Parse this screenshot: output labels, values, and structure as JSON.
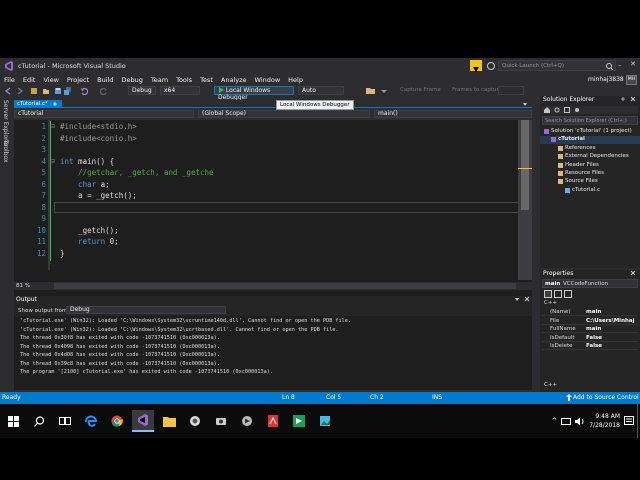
{
  "window": {
    "title": "cTutorial - Microsoft Visual Studio",
    "quick_launch": "Quick Launch (Ctrl+Q)",
    "user": "minhaj3838",
    "user_initials": "MH"
  },
  "menu": [
    "File",
    "Edit",
    "View",
    "Project",
    "Build",
    "Debug",
    "Team",
    "Tools",
    "Test",
    "Analyze",
    "Window",
    "Help"
  ],
  "toolbar": {
    "config": "Debug",
    "platform": "x64",
    "debugger_label": "Local Windows Debugger",
    "auto": "Auto",
    "capture_frame": "Capture Frame",
    "frames_to_capture": "Frames to capture:"
  },
  "tooltip": "Local Windows Debugger",
  "side_tabs": [
    "Server Explorer",
    "Toolbox"
  ],
  "editor": {
    "tab": "cTutorial.c*",
    "nav_project": "cTutorial",
    "nav_scope": "(Global Scope)",
    "nav_function": "main()",
    "zoom": "81 %",
    "lines": [
      {
        "n": "1",
        "segs": [
          {
            "t": "pp",
            "s": "#include<stdio.h>"
          }
        ]
      },
      {
        "n": "2",
        "segs": [
          {
            "t": "pp",
            "s": "#include<conio.h>"
          }
        ]
      },
      {
        "n": "3",
        "segs": []
      },
      {
        "n": "4",
        "segs": [
          {
            "t": "kw",
            "s": "int"
          },
          {
            "t": "tx",
            "s": " main() {"
          }
        ]
      },
      {
        "n": "5",
        "segs": [
          {
            "t": "cm",
            "s": "    //getchar, _getch, and _getche"
          }
        ]
      },
      {
        "n": "6",
        "segs": [
          {
            "t": "kw",
            "s": "    char"
          },
          {
            "t": "tx",
            "s": " a;"
          }
        ]
      },
      {
        "n": "7",
        "segs": [
          {
            "t": "tx",
            "s": "    a = _getch();"
          }
        ]
      },
      {
        "n": "8",
        "segs": []
      },
      {
        "n": "9",
        "segs": []
      },
      {
        "n": "10",
        "segs": [
          {
            "t": "tx",
            "s": "    _getch();"
          }
        ]
      },
      {
        "n": "11",
        "segs": [
          {
            "t": "kw",
            "s": "    return"
          },
          {
            "t": "tx",
            "s": " 0;"
          }
        ]
      },
      {
        "n": "12",
        "segs": [
          {
            "t": "tx",
            "s": "}"
          }
        ]
      }
    ]
  },
  "output": {
    "title": "Output",
    "show_from_label": "Show output from:",
    "show_from_value": "Debug",
    "lines": [
      "'cTutorial.exe' (Win32): Loaded 'C:\\Windows\\System32\\vcruntime140d.dll'. Cannot find or open the PDB file.",
      "'cTutorial.exe' (Win32): Loaded 'C:\\Windows\\System32\\ucrtbased.dll'. Cannot find or open the PDB file.",
      "The thread 0x30f8 has exited with code -1073741510 (0xc000013a).",
      "The thread 0x4098 has exited with code -1073741510 (0xc000013a).",
      "The thread 0x4d08 has exited with code -1073741510 (0xc000013a).",
      "The thread 0x39c8 has exited with code -1073741510 (0xc000013a).",
      "The program '[2100] cTutorial.exe' has exited with code -1073741510 (0xc000013a)."
    ]
  },
  "solution_explorer": {
    "title": "Solution Explorer",
    "search": "Search Solution Explorer (Ctrl+;)",
    "items": [
      {
        "label": "Solution 'cTutorial' (1 project)",
        "indent": 0,
        "bold": false,
        "sel": false
      },
      {
        "label": "cTutorial",
        "indent": 1,
        "bold": true,
        "sel": true
      },
      {
        "label": "References",
        "indent": 2,
        "bold": false,
        "sel": false
      },
      {
        "label": "External Dependencies",
        "indent": 2,
        "bold": false,
        "sel": false
      },
      {
        "label": "Header Files",
        "indent": 2,
        "bold": false,
        "sel": false
      },
      {
        "label": "Resource Files",
        "indent": 2,
        "bold": false,
        "sel": false
      },
      {
        "label": "Source Files",
        "indent": 2,
        "bold": false,
        "sel": false
      },
      {
        "label": "cTutorial.c",
        "indent": 3,
        "bold": false,
        "sel": false
      }
    ]
  },
  "properties": {
    "title": "Properties",
    "object": "main",
    "object_type": "VCCodeFunction",
    "category": "C++",
    "rows": [
      {
        "k": "(Name)",
        "v": "main"
      },
      {
        "k": "File",
        "v": "C:\\Users\\Minhaj"
      },
      {
        "k": "FullName",
        "v": "main"
      },
      {
        "k": "IsDefault",
        "v": "False"
      },
      {
        "k": "IsDelete",
        "v": "False"
      }
    ],
    "footer": "C++"
  },
  "status": {
    "left": "Ready",
    "ln": "Ln 8",
    "col": "Col 5",
    "ch": "Ch 2",
    "ins": "INS",
    "source_control": "Add to Source Control"
  },
  "taskbar": {
    "time": "9:48 AM",
    "date": "7/28/2018"
  },
  "colors": {
    "accent": "#007acc",
    "editor_bg": "#1e1e1e",
    "chrome_bg": "#2d2d30",
    "keyword": "#569cd6",
    "comment": "#57a64a",
    "preprocessor": "#9b9b9b",
    "debug_green": "#3fb950"
  }
}
